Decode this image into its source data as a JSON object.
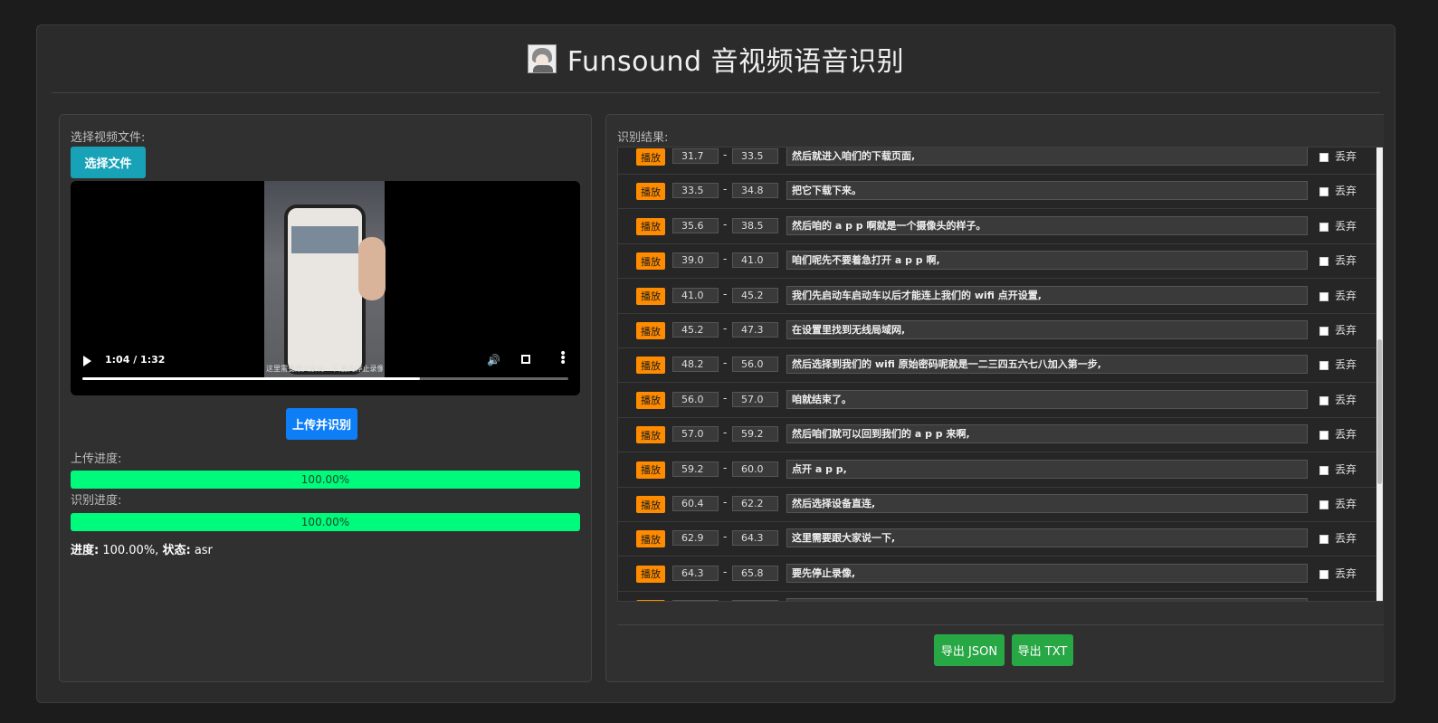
{
  "app": {
    "title": "Funsound 音视频语音识别",
    "logo_icon": "anime-avatar-icon"
  },
  "left": {
    "select_label": "选择视频文件:",
    "select_button": "选择文件",
    "video": {
      "time": "1:04 / 1:32",
      "progress": 0.695,
      "subtitle": "这里需要跟大家说一下,要先停止录像"
    },
    "upload_button": "上传并识别",
    "upload_label": "上传进度:",
    "upload_progress": "100.00%",
    "recog_label": "识别进度:",
    "recog_progress": "100.00%",
    "status": {
      "progress_key": "进度:",
      "progress_value": "100.00%,",
      "state_key": "状态:",
      "state_value": "asr"
    }
  },
  "right": {
    "results_label": "识别结果:",
    "play_label": "播放",
    "discard_label": "丢弃",
    "segments": [
      {
        "start": "31.7",
        "end": "33.5",
        "text": "然后就进入咱们的下载页面,"
      },
      {
        "start": "33.5",
        "end": "34.8",
        "text": "把它下载下来。"
      },
      {
        "start": "35.6",
        "end": "38.5",
        "text": "然后咱的 a p p 啊就是一个摄像头的样子。"
      },
      {
        "start": "39.0",
        "end": "41.0",
        "text": "咱们呢先不要着急打开 a p p 啊,"
      },
      {
        "start": "41.0",
        "end": "45.2",
        "text": "我们先启动车启动车以后才能连上我们的 wifi 点开设置,"
      },
      {
        "start": "45.2",
        "end": "47.3",
        "text": "在设置里找到无线局域网,"
      },
      {
        "start": "48.2",
        "end": "56.0",
        "text": "然后选择到我们的 wifi 原始密码呢就是一二三四五六七八加入第一步,"
      },
      {
        "start": "56.0",
        "end": "57.0",
        "text": "咱就结束了。"
      },
      {
        "start": "57.0",
        "end": "59.2",
        "text": "然后咱们就可以回到我们的 a p p 来啊,"
      },
      {
        "start": "59.2",
        "end": "60.0",
        "text": "点开 a p p,"
      },
      {
        "start": "60.4",
        "end": "62.2",
        "text": "然后选择设备直连,"
      },
      {
        "start": "62.9",
        "end": "64.3",
        "text": "这里需要跟大家说一下,"
      },
      {
        "start": "64.3",
        "end": "65.8",
        "text": "要先停止录像,"
      },
      {
        "start": "",
        "end": "",
        "text": ""
      }
    ],
    "export_json": "导出 JSON",
    "export_txt": "导出 TXT"
  }
}
